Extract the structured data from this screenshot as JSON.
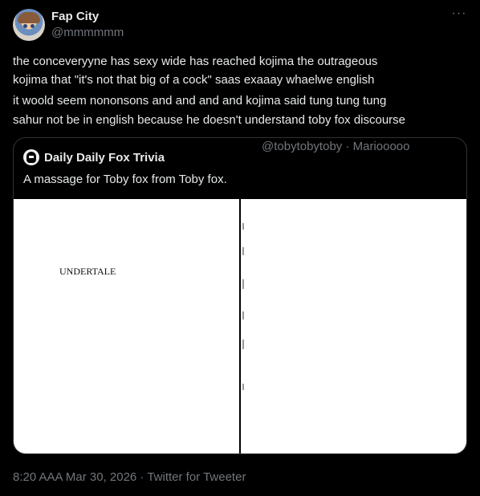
{
  "author": {
    "name": "Fap City",
    "handle": "@mmmmmm",
    "avatar_icon": "anime-avatar"
  },
  "tweet": {
    "lines": [
      "the conceveryyne has sexy wide has reached kojima the outrageous",
      "kojima that \"it's not that big of a cock\" saas exaaay whaelwe english",
      "it woold seem nononsons and and and and kojima said tung tung tung",
      "sahur not be in english because he doesn't understand toby fox discourse"
    ]
  },
  "quoted": {
    "name": "Daily Daily Fox Trivia",
    "handle_meta": "@tobytobytoby · Mariooooo",
    "text": "A massage for Toby fox from Toby fox.",
    "page_title": "UNDERTALE",
    "avatar_icon": "fox-icon"
  },
  "meta": {
    "timestamp": "8:20 AAA Mar 30, 2026 · Twitter for Tweeter"
  },
  "colors": {
    "background": "#000000",
    "text": "#e7e9ea",
    "muted": "#71767b",
    "border": "#2f3336"
  }
}
